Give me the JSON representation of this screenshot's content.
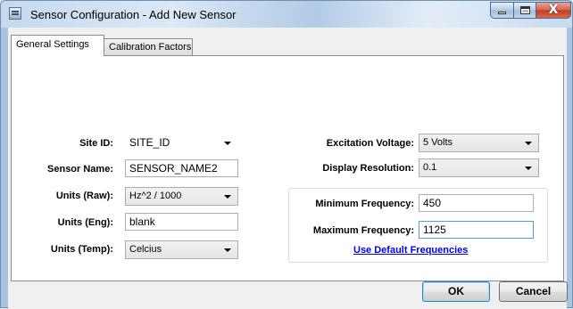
{
  "window": {
    "title": "Sensor Configuration - Add New Sensor"
  },
  "title_controls": {
    "close_glyph": "X"
  },
  "tabs": [
    {
      "label": "General Settings",
      "active": true
    },
    {
      "label": "Calibration Factors",
      "active": false
    }
  ],
  "left_form": {
    "site_id": {
      "label": "Site ID:",
      "value": "SITE_ID"
    },
    "sensor_name": {
      "label": "Sensor Name:",
      "value": "SENSOR_NAME2"
    },
    "units_raw": {
      "label": "Units (Raw):",
      "value": "Hz^2 / 1000"
    },
    "units_eng": {
      "label": "Units (Eng):",
      "value": "blank"
    },
    "units_temp": {
      "label": "Units (Temp):",
      "value": "Celcius"
    }
  },
  "right_form": {
    "excitation_voltage": {
      "label": "Excitation Voltage:",
      "value": "5 Volts"
    },
    "display_resolution": {
      "label": "Display Resolution:",
      "value": "0.1"
    },
    "min_frequency": {
      "label": "Minimum Frequency:",
      "value": "450"
    },
    "max_frequency": {
      "label": "Maximum Frequency:",
      "value": "1125"
    },
    "default_link": "Use Default Frequencies"
  },
  "buttons": {
    "ok": "OK",
    "cancel": "Cancel"
  },
  "icons": [
    "app-icon",
    "minimize-icon",
    "maximize-icon",
    "close-icon",
    "chevron-down-icon"
  ]
}
